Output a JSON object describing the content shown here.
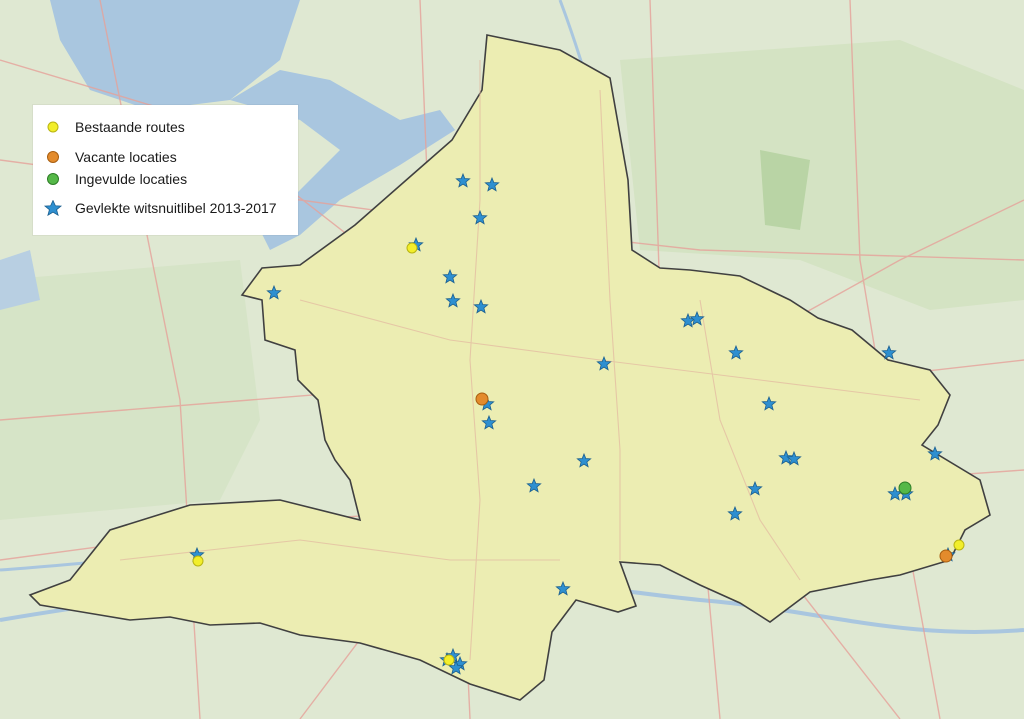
{
  "map": {
    "legend": [
      {
        "label": "Bestaande routes",
        "symbol": "circle",
        "color": "#f2ee2b"
      },
      {
        "label": "Vacante locaties",
        "symbol": "circle",
        "color": "#e38b2c"
      },
      {
        "label": "Ingevulde locaties",
        "symbol": "circle",
        "color": "#55b848"
      },
      {
        "label": "Gevlekte witsnuitlibel 2013-2017",
        "symbol": "star",
        "color": "#2e8fd0"
      }
    ],
    "colors": {
      "region_fill": "#ecedb2",
      "region_border": "#404040",
      "water": "#a9c6df",
      "land": "#dfe8d2",
      "roads": "#e6a29a"
    }
  }
}
